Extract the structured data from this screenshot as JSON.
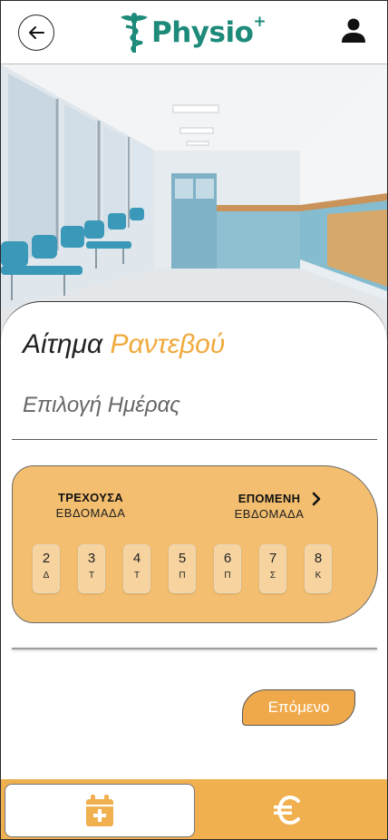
{
  "header": {
    "logo_text": "Physio",
    "logo_plus": "+"
  },
  "card": {
    "title_part1": "Αίτημα",
    "title_part2": "Ραντεβού",
    "subtitle": "Επιλογή Ημέρας"
  },
  "week": {
    "current_a": "ΤΡΕΧΟΥΣΑ",
    "current_b": "ΕΒΔΟΜΑΔΑ",
    "next_a": "ΕΠΟΜΕΝΗ",
    "next_b": "ΕΒΔΟΜΑΔΑ",
    "days": [
      {
        "num": "2",
        "letter": "Δ"
      },
      {
        "num": "3",
        "letter": "Τ"
      },
      {
        "num": "4",
        "letter": "Τ"
      },
      {
        "num": "5",
        "letter": "Π"
      },
      {
        "num": "6",
        "letter": "Π"
      },
      {
        "num": "7",
        "letter": "Σ"
      },
      {
        "num": "8",
        "letter": "Κ"
      }
    ]
  },
  "actions": {
    "next_label": "Επόμενο"
  },
  "colors": {
    "brand_teal": "#1d8a7a",
    "accent_orange": "#f0a93c",
    "panel_orange": "#f3be6f",
    "bar_orange": "#f0b04f"
  }
}
